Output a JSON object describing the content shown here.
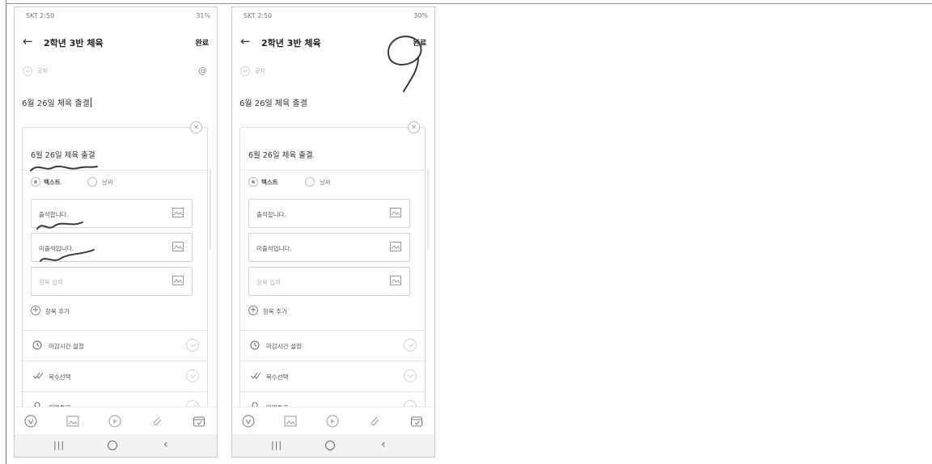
{
  "phones": [
    {
      "status": {
        "carrier_time": "SKT 2:50",
        "right": "31%"
      },
      "title": "2학년 3반 체육",
      "done": "완료",
      "notice": "공지",
      "post_title": "6월 26일 체육 출결",
      "card": {
        "title": "6월 26일 체육 출결",
        "type_text": "텍스트",
        "type_date": "날짜",
        "options": [
          "출석합니다.",
          "미출석입니다."
        ],
        "option_placeholder": "항목 입력",
        "add_option": "항목 추가",
        "settings": [
          "마감시간 설정",
          "복수선택",
          "익명투표"
        ]
      }
    },
    {
      "status": {
        "carrier_time": "SKT 2:50",
        "right": "30%"
      },
      "title": "2학년 3반 체육",
      "done": "완료",
      "notice": "공지",
      "post_title": "6월 26일 체육 출결",
      "card": {
        "title": "6월 26일 체육 출결",
        "type_text": "텍스트",
        "type_date": "날짜",
        "options": [
          "출석합니다.",
          "미출석입니다."
        ],
        "option_placeholder": "항목 입력",
        "add_option": "항목 추가",
        "settings": [
          "마감시간 설정",
          "복수선택",
          "익명투표"
        ]
      }
    }
  ],
  "icons": {
    "back": "arrow-left-icon",
    "mention": "at-icon",
    "close": "close-icon",
    "image": "image-icon",
    "add": "plus-circle-icon",
    "deadline": "clock-icon",
    "multiple": "double-check-icon",
    "anonymous": "person-icon",
    "toolbar": [
      "vote-icon",
      "image-icon",
      "video-icon",
      "attach-icon",
      "calendar-icon"
    ]
  },
  "colors": {
    "annotation": "#3a3a3a",
    "divider": "#e6e6e6"
  }
}
